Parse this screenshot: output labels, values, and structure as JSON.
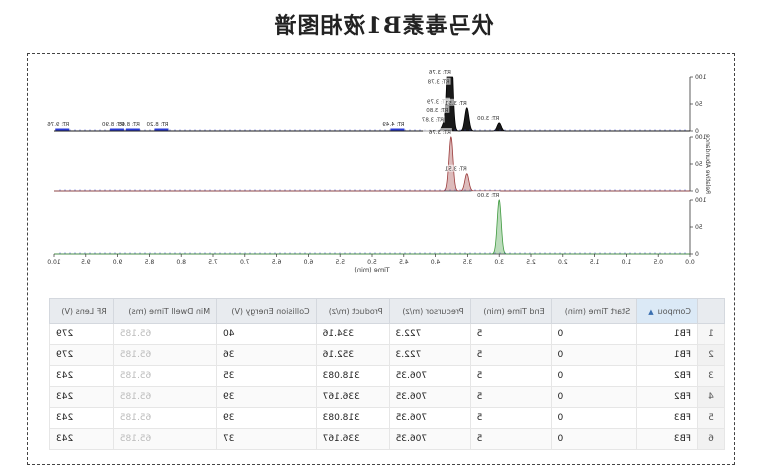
{
  "title": "伏马毒素B1液相图谱",
  "chart_data": {
    "type": "line",
    "xlabel": "Time (min)",
    "ylabel": "Relative Abundance",
    "xlim": [
      0.0,
      10.0
    ],
    "xticks": [
      "0.0",
      "0.5",
      "1.0",
      "1.5",
      "2.0",
      "2.5",
      "3.0",
      "3.5",
      "4.0",
      "4.5",
      "5.0",
      "5.5",
      "6.0",
      "6.5",
      "7.0",
      "7.5",
      "8.0",
      "8.5",
      "9.0",
      "9.5",
      "10.0"
    ],
    "yticks": [
      "0",
      "50",
      "100"
    ],
    "panels": [
      {
        "name": "",
        "color": "#000000",
        "peaks": [
          {
            "rt": 3.76,
            "height": 100,
            "label": "RT: 3.76"
          },
          {
            "rt": 3.78,
            "height": 82,
            "label": "RT: 3.78"
          },
          {
            "rt": 3.79,
            "height": 45,
            "label": "RT: 3.79"
          },
          {
            "rt": 3.8,
            "height": 30,
            "label": "RT: 3.80"
          },
          {
            "rt": 3.87,
            "height": 12,
            "label": "RT: 3.87"
          },
          {
            "rt": 3.51,
            "height": 43,
            "label": "RT: 3.51"
          },
          {
            "rt": 3.0,
            "height": 15,
            "label": "RT: 3.00"
          }
        ],
        "text_labels": [
          "RT: 4.49",
          "RT: 8.20",
          "RT: 8.65",
          "RT: 8.90",
          "RT: 9.76"
        ]
      },
      {
        "name": "",
        "color": "#9b3b3b",
        "peaks": [
          {
            "rt": 3.76,
            "height": 100,
            "label": "RT: 3.76"
          },
          {
            "rt": 3.51,
            "height": 32,
            "label": "RT: 3.51"
          }
        ]
      },
      {
        "name": "",
        "color": "#3f9a3f",
        "peaks": [
          {
            "rt": 3.0,
            "height": 100,
            "label": "RT: 3.00"
          }
        ]
      }
    ]
  },
  "table": {
    "sort_column": 0,
    "columns": [
      "Compou",
      "Start Time (min)",
      "End Time (min)",
      "Precursor (m/z)",
      "Product (m/z)",
      "Collision Energy (V)",
      "Min Dwell Time (ms)",
      "RF Lens (V)"
    ],
    "rows": [
      {
        "index": "1",
        "cells": [
          "FB1",
          "0",
          "5",
          "722.3",
          "334.16",
          "40",
          "65.185",
          "279"
        ]
      },
      {
        "index": "2",
        "cells": [
          "FB1",
          "0",
          "5",
          "722.3",
          "352.16",
          "36",
          "65.185",
          "279"
        ]
      },
      {
        "index": "3",
        "cells": [
          "FB2",
          "0",
          "5",
          "706.35",
          "318.083",
          "35",
          "65.185",
          "243"
        ]
      },
      {
        "index": "4",
        "cells": [
          "FB2",
          "0",
          "5",
          "706.35",
          "336.167",
          "39",
          "65.185",
          "243"
        ]
      },
      {
        "index": "5",
        "cells": [
          "FB3",
          "0",
          "5",
          "706.35",
          "318.083",
          "39",
          "65.185",
          "243"
        ]
      },
      {
        "index": "6",
        "cells": [
          "FB3",
          "0",
          "5",
          "706.35",
          "336.167",
          "37",
          "65.185",
          "243"
        ]
      }
    ]
  }
}
